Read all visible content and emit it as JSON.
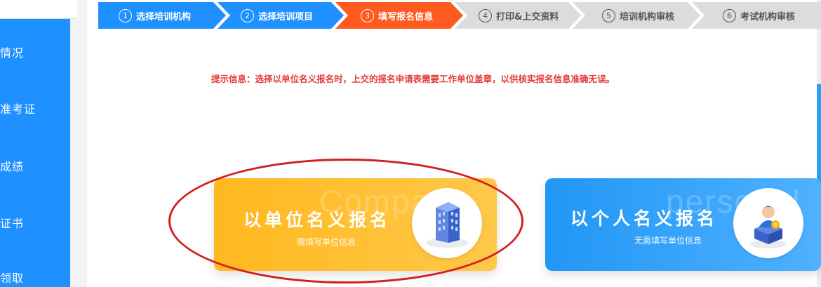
{
  "sidebar": {
    "items": [
      {
        "label": "情况"
      },
      {
        "label": "准考证"
      },
      {
        "label": "成绩"
      },
      {
        "label": "证书"
      },
      {
        "label": "领取"
      }
    ]
  },
  "steps": [
    {
      "num": "1",
      "label": "选择培训机构",
      "state": "done"
    },
    {
      "num": "2",
      "label": "选择培训项目",
      "state": "done"
    },
    {
      "num": "3",
      "label": "填写报名信息",
      "state": "current"
    },
    {
      "num": "4",
      "label": "打印&上交资料",
      "state": "todo"
    },
    {
      "num": "5",
      "label": "培训机构审核",
      "state": "todo"
    },
    {
      "num": "6",
      "label": "考试机构审核",
      "state": "todo"
    }
  ],
  "hint": "提示信息：选择以单位名义报名时，上交的报名申请表需要工作单位盖章，以供核实报名信息准确无误。",
  "cards": {
    "company": {
      "watermark": "Company",
      "title": "以单位名义报名",
      "subtitle": "需填写单位信息",
      "icon": "building-icon"
    },
    "personal": {
      "watermark": "personal",
      "title": "以个人名义报名",
      "subtitle": "无需填写单位信息",
      "icon": "person-icon"
    }
  },
  "colors": {
    "done": "#1e90ff",
    "current": "#ff5a1f",
    "todo": "#dcdcdc",
    "company_card": "#ffb81f",
    "personal_card": "#2197f5",
    "annotation": "#d21f1f"
  }
}
